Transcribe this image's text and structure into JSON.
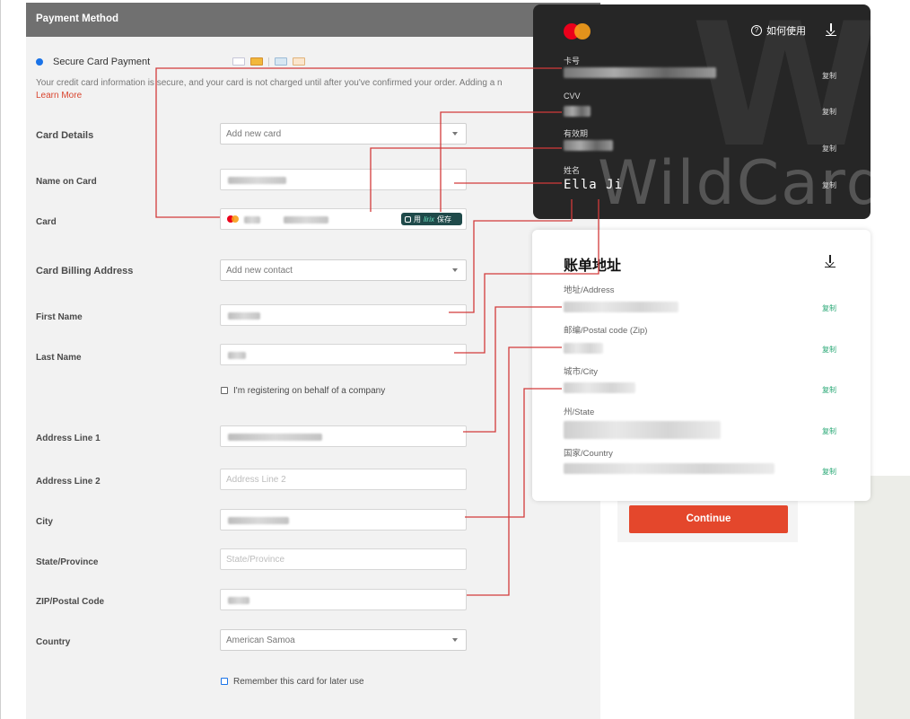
{
  "form": {
    "header": "Payment Method",
    "secure_label": "Secure Card Payment",
    "notice": "Your credit card information is secure, and your card is not charged until after you've confirmed your order. Adding a n",
    "learn_more": "Learn More",
    "card_details_label": "Card Details",
    "card_select": "Add new card",
    "name_on_card_label": "Name on Card",
    "card_label": "Card",
    "save_pill_prefix": "用",
    "save_pill_brand": "lirix",
    "save_pill_suffix": "保存",
    "billing_address_label": "Card Billing Address",
    "contact_select": "Add new contact",
    "first_name_label": "First Name",
    "last_name_label": "Last Name",
    "company_checkbox_label": "I'm registering on behalf of a company",
    "address1_label": "Address Line 1",
    "address2_label": "Address Line 2",
    "address2_placeholder": "Address Line 2",
    "city_label": "City",
    "state_label": "State/Province",
    "state_placeholder": "State/Province",
    "zip_label": "ZIP/Postal Code",
    "country_label": "Country",
    "country_value": "American Samoa",
    "remember_label": "Remember this card for later use"
  },
  "summary": {
    "continue_label": "Continue"
  },
  "card_overlay": {
    "help_label": "如何使用",
    "number_label": "卡号",
    "cvv_label": "CVV",
    "expiry_label": "有效期",
    "name_label": "姓名",
    "name_value": "Ella Ji",
    "copy_label": "复制",
    "watermark": "WildCard"
  },
  "billing_overlay": {
    "title": "账单地址",
    "address_label": "地址/Address",
    "postal_label": "邮编/Postal code (Zip)",
    "city_label": "城市/City",
    "state_label": "州/State",
    "country_label": "国家/Country",
    "copy_label": "复制"
  },
  "colors": {
    "accent": "#e4472c",
    "connector": "#d23b3b",
    "copy_green": "#2aa876",
    "card_bg": "#262626"
  },
  "icons": [
    "mastercard-icon",
    "help-icon",
    "download-icon",
    "chevron-down-icon",
    "checkbox-icon",
    "radio-icon"
  ]
}
